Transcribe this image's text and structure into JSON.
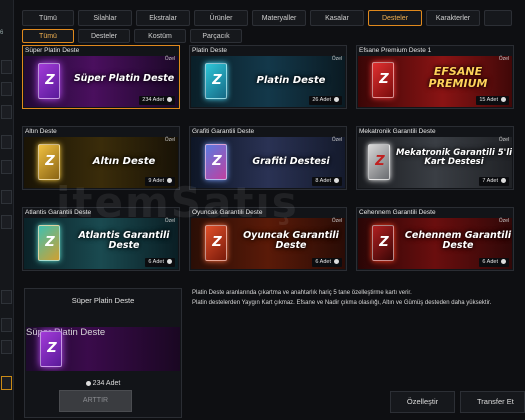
{
  "left_strip": {
    "value": "6"
  },
  "category_tabs": [
    {
      "label": "Tümü"
    },
    {
      "label": "Silahlar"
    },
    {
      "label": "Ekstralar"
    },
    {
      "label": "Ürünler"
    },
    {
      "label": "Materyaller"
    },
    {
      "label": "Kasalar"
    },
    {
      "label": "Desteler",
      "active": true
    },
    {
      "label": "Karakterler"
    },
    {
      "label": ""
    }
  ],
  "sub_tabs": [
    {
      "label": "Tümü",
      "active": true
    },
    {
      "label": "Desteler"
    },
    {
      "label": "Kostüm"
    },
    {
      "label": "Parçacık"
    }
  ],
  "decks": [
    {
      "title": "Süper Platin Deste",
      "pack_name": "Süper Platin Deste",
      "count": "234 Adet",
      "badge": "Özel",
      "theme": "purple",
      "selected": true
    },
    {
      "title": "Platin Deste",
      "pack_name": "Platin Deste",
      "count": "26 Adet",
      "badge": "Özel",
      "theme": "teal"
    },
    {
      "title": "Efsane Premium Deste 1",
      "pack_name": "EFSANE PREMIUM",
      "count": "15 Adet",
      "badge": "Özel",
      "theme": "red"
    },
    {
      "title": "Altın Deste",
      "pack_name": "Altın Deste",
      "count": "9 Adet",
      "badge": "Özel",
      "theme": "gold"
    },
    {
      "title": "Grafiti Garantili Deste",
      "pack_name": "Grafiti Destesi",
      "count": "8 Adet",
      "badge": "Özel",
      "theme": "graffiti"
    },
    {
      "title": "Mekatronik Garantili Deste",
      "pack_name": "Mekatronik Garantili 5'li Kart Destesi",
      "count": "7 Adet",
      "badge": "Özel",
      "theme": "mecha"
    },
    {
      "title": "Atlantis Garantili Deste",
      "pack_name": "Atlantis Garantili Deste",
      "count": "6 Adet",
      "badge": "Özel",
      "theme": "atlantis"
    },
    {
      "title": "Oyuncak Garantili Deste",
      "pack_name": "Oyuncak Garantili Deste",
      "count": "6 Adet",
      "badge": "Özel",
      "theme": "toy"
    },
    {
      "title": "Cehennem Garantili Deste",
      "pack_name": "Cehennem Garantili Deste",
      "count": "6 Adet",
      "badge": "Özel",
      "theme": "hell"
    }
  ],
  "detail": {
    "title": "Süper Platin Deste",
    "pack_name": "Süper Platin Deste",
    "count": "234 Adet",
    "button_label": "ARTTIR"
  },
  "description": {
    "line1": "Platin Deste aranlarında çıkartma ve anahtarlık hariç 5 tane özelleştirme kartı verir.",
    "line2": "Platin destelerden Yaygın Kart çıkmaz. Efsane ve Nadir çıkma olasılığı, Altın ve Gümüş desteden daha yüksektir."
  },
  "actions": {
    "customize_label": "Özelleştir",
    "transfer_label": "Transfer Et"
  },
  "watermark": "itemSatış",
  "theme_colors": {
    "accent": "#e0891d",
    "card_bg": "#121418",
    "border": "#2a2d33"
  }
}
